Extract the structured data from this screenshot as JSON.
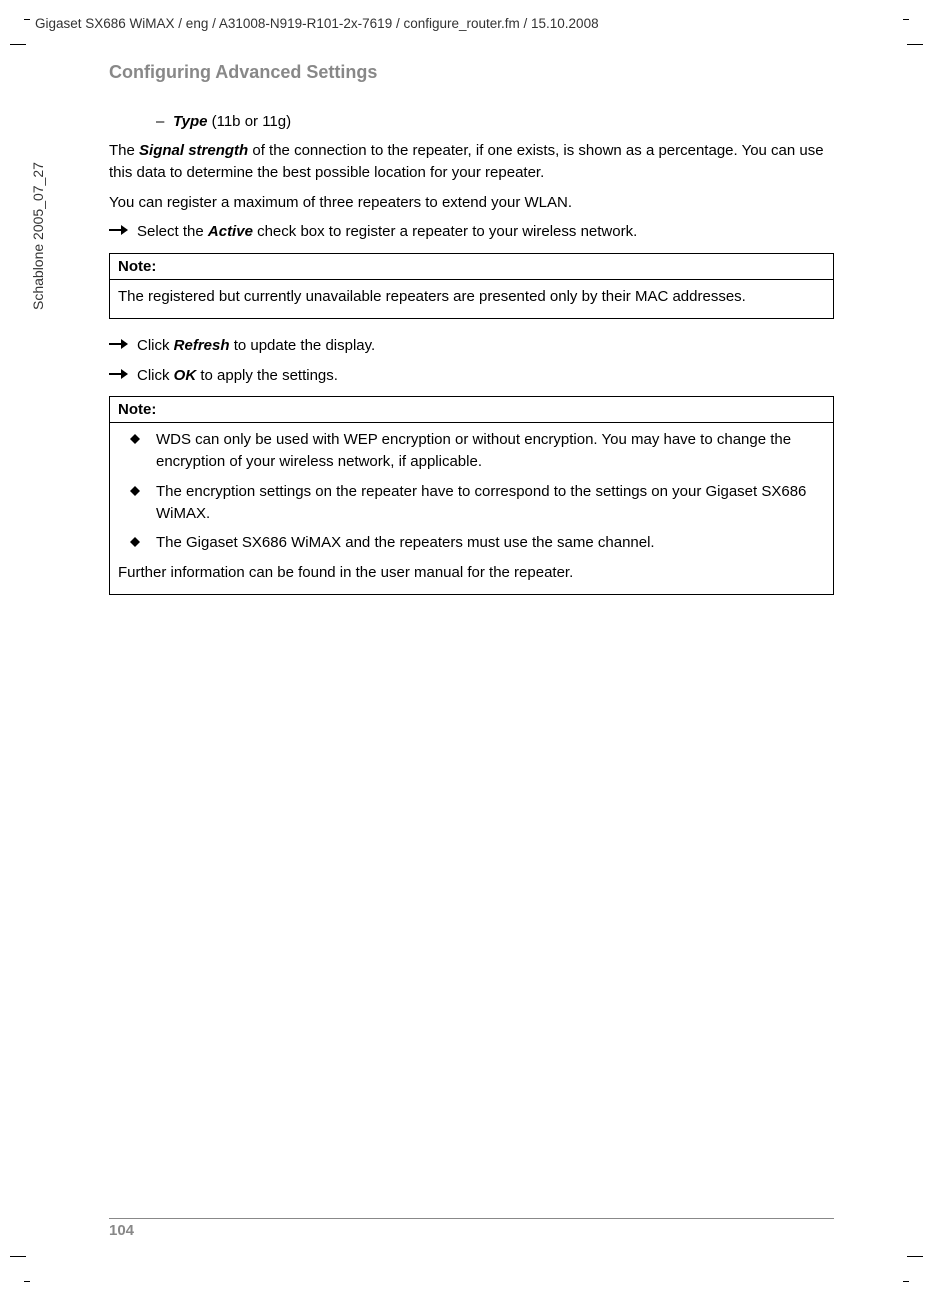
{
  "header": {
    "path": "Gigaset SX686 WiMAX / eng / A31008-N919-R101-2x-7619 / configure_router.fm / 15.10.2008"
  },
  "sidebar": {
    "template": "Schablone 2005_07_27"
  },
  "section": {
    "heading": "Configuring Advanced Settings"
  },
  "subitem": {
    "label": "Type",
    "suffix": " (11b or 11g)"
  },
  "para1": {
    "prefix": "The ",
    "bold": "Signal strength",
    "suffix": " of the connection to the repeater, if one exists, is shown as a percentage. You can use this data to determine the best possible location for your repeater."
  },
  "para2": {
    "text": "You can register a maximum of three repeaters to extend your WLAN."
  },
  "arrow1": {
    "prefix": "Select the ",
    "bold": "Active",
    "suffix": " check box to register a repeater to your wireless network."
  },
  "note1": {
    "header": "Note:",
    "body": "The registered but currently unavailable repeaters are presented only by their MAC addresses."
  },
  "arrow2": {
    "prefix": "Click ",
    "bold": "Refresh",
    "suffix": " to update the display."
  },
  "arrow3": {
    "prefix": "Click ",
    "bold": "OK",
    "suffix": " to apply the settings."
  },
  "note2": {
    "header": "Note:",
    "diamond1": "WDS can only be used with WEP encryption or without encryption. You may have to change the encryption of your wireless network, if applicable.",
    "diamond2": "The encryption settings on the repeater have to correspond to the settings on your Gigaset SX686 WiMAX.",
    "diamond3": "The Gigaset SX686 WiMAX and the repeaters must use the same channel.",
    "footer": "Further information can be found in the user manual for the repeater."
  },
  "page": {
    "number": "104"
  }
}
